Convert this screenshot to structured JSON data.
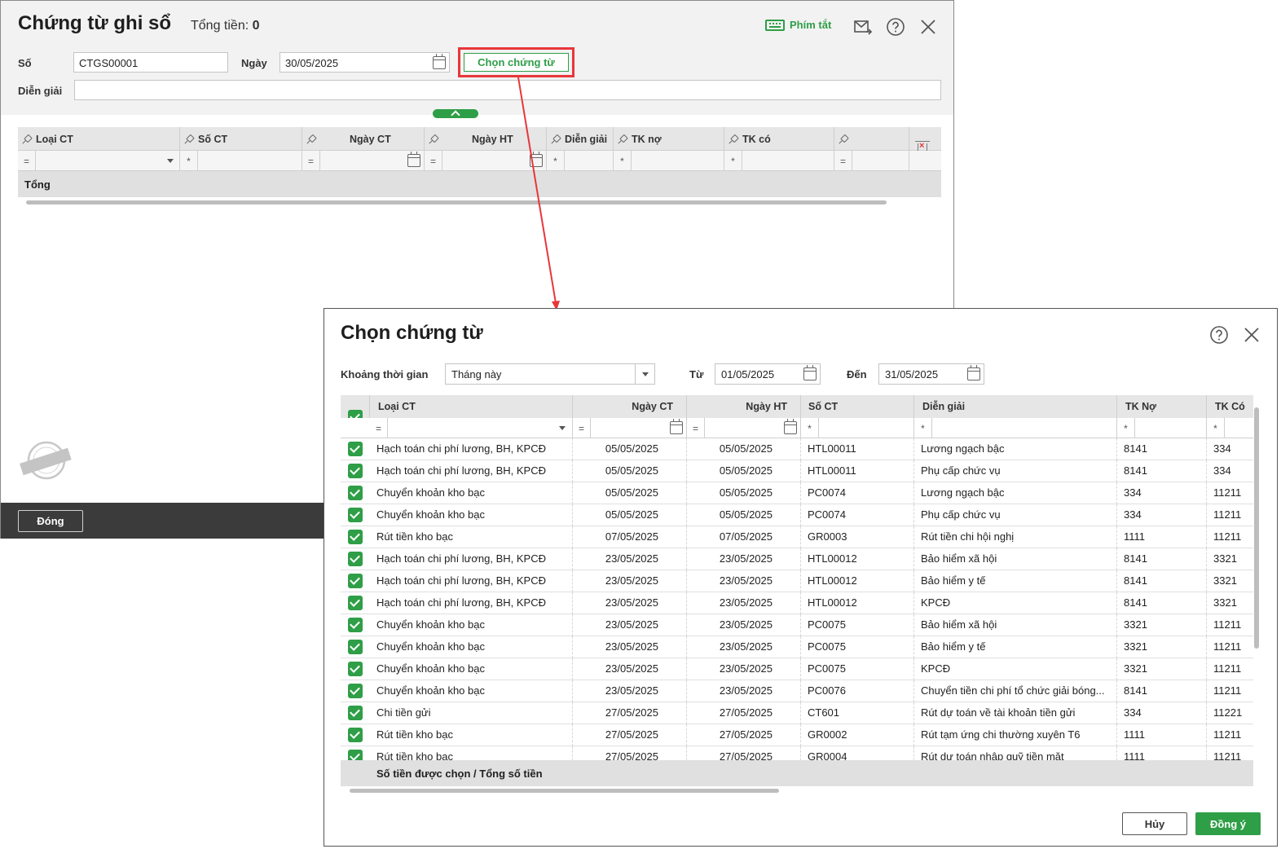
{
  "colors": {
    "accent": "#2e9e47",
    "highlight": "#e8363a",
    "footer_dark": "#3b3b3b"
  },
  "main": {
    "title": "Chứng từ ghi sổ",
    "total_label": "Tổng tiền:",
    "total_value": "0",
    "shortcut_label": "Phím tắt",
    "so_label": "Số",
    "so_value": "CTGS00001",
    "ngay_label": "Ngày",
    "ngay_value": "30/05/2025",
    "choose_button": "Chọn chứng từ",
    "dien_giai_label": "Diễn giải",
    "dien_giai_value": "",
    "grid": {
      "columns": [
        "Loại CT",
        "Số CT",
        "Ngày CT",
        "Ngày HT",
        "Diễn giải",
        "TK nợ",
        "TK có",
        ""
      ],
      "filter_ops": [
        "=",
        "*",
        "=",
        "=",
        "*",
        "*",
        "*",
        "="
      ],
      "total_label": "Tổng"
    },
    "close_button": "Đóng",
    "watermark": "DỮ LIỆU MẪU"
  },
  "dialog": {
    "title": "Chọn chứng từ",
    "period_label": "Khoảng thời gian",
    "period_value": "Tháng này",
    "from_label": "Từ",
    "from_value": "01/05/2025",
    "to_label": "Đến",
    "to_value": "31/05/2025",
    "columns": [
      "Loại CT",
      "Ngày CT",
      "Ngày HT",
      "Số CT",
      "Diễn giải",
      "TK Nợ",
      "TK Có"
    ],
    "filter_ops": [
      "=",
      "=",
      "=",
      "*",
      "*",
      "*",
      "*"
    ],
    "rows": [
      {
        "loai": "Hạch toán chi phí lương, BH, KPCĐ",
        "ngay_ct": "05/05/2025",
        "ngay_ht": "05/05/2025",
        "so": "HTL00011",
        "dien_giai": "Lương ngạch bậc",
        "tk_no": "8141",
        "tk_co": "334"
      },
      {
        "loai": "Hạch toán chi phí lương, BH, KPCĐ",
        "ngay_ct": "05/05/2025",
        "ngay_ht": "05/05/2025",
        "so": "HTL00011",
        "dien_giai": "Phụ cấp chức vụ",
        "tk_no": "8141",
        "tk_co": "334"
      },
      {
        "loai": "Chuyển khoản kho bạc",
        "ngay_ct": "05/05/2025",
        "ngay_ht": "05/05/2025",
        "so": "PC0074",
        "dien_giai": "Lương ngạch bậc",
        "tk_no": "334",
        "tk_co": "11211"
      },
      {
        "loai": "Chuyển khoản kho bạc",
        "ngay_ct": "05/05/2025",
        "ngay_ht": "05/05/2025",
        "so": "PC0074",
        "dien_giai": "Phụ cấp chức vụ",
        "tk_no": "334",
        "tk_co": "11211"
      },
      {
        "loai": "Rút tiền kho bạc",
        "ngay_ct": "07/05/2025",
        "ngay_ht": "07/05/2025",
        "so": "GR0003",
        "dien_giai": "Rút tiền chi hội nghị",
        "tk_no": "1111",
        "tk_co": "11211"
      },
      {
        "loai": "Hạch toán chi phí lương, BH, KPCĐ",
        "ngay_ct": "23/05/2025",
        "ngay_ht": "23/05/2025",
        "so": "HTL00012",
        "dien_giai": "Bảo hiểm xã hội",
        "tk_no": "8141",
        "tk_co": "3321"
      },
      {
        "loai": "Hạch toán chi phí lương, BH, KPCĐ",
        "ngay_ct": "23/05/2025",
        "ngay_ht": "23/05/2025",
        "so": "HTL00012",
        "dien_giai": "Bảo hiểm y tế",
        "tk_no": "8141",
        "tk_co": "3321"
      },
      {
        "loai": "Hạch toán chi phí lương, BH, KPCĐ",
        "ngay_ct": "23/05/2025",
        "ngay_ht": "23/05/2025",
        "so": "HTL00012",
        "dien_giai": "KPCĐ",
        "tk_no": "8141",
        "tk_co": "3321"
      },
      {
        "loai": "Chuyển khoản kho bạc",
        "ngay_ct": "23/05/2025",
        "ngay_ht": "23/05/2025",
        "so": "PC0075",
        "dien_giai": "Bảo hiểm xã hội",
        "tk_no": "3321",
        "tk_co": "11211"
      },
      {
        "loai": "Chuyển khoản kho bạc",
        "ngay_ct": "23/05/2025",
        "ngay_ht": "23/05/2025",
        "so": "PC0075",
        "dien_giai": "Bảo hiểm y tế",
        "tk_no": "3321",
        "tk_co": "11211"
      },
      {
        "loai": "Chuyển khoản kho bạc",
        "ngay_ct": "23/05/2025",
        "ngay_ht": "23/05/2025",
        "so": "PC0075",
        "dien_giai": "KPCĐ",
        "tk_no": "3321",
        "tk_co": "11211"
      },
      {
        "loai": "Chuyển khoản kho bạc",
        "ngay_ct": "23/05/2025",
        "ngay_ht": "23/05/2025",
        "so": "PC0076",
        "dien_giai": "Chuyển tiền chi phí tổ chức giải bóng...",
        "tk_no": "8141",
        "tk_co": "11211"
      },
      {
        "loai": "Chi tiền gửi",
        "ngay_ct": "27/05/2025",
        "ngay_ht": "27/05/2025",
        "so": "CT601",
        "dien_giai": "Rút dự toán về tài khoản tiền gửi",
        "tk_no": "334",
        "tk_co": "11221"
      },
      {
        "loai": "Rút tiền kho bạc",
        "ngay_ct": "27/05/2025",
        "ngay_ht": "27/05/2025",
        "so": "GR0002",
        "dien_giai": "Rút tạm ứng chi thường xuyên T6",
        "tk_no": "1111",
        "tk_co": "11211"
      },
      {
        "loai": "Rút tiền kho bạc",
        "ngay_ct": "27/05/2025",
        "ngay_ht": "27/05/2025",
        "so": "GR0004",
        "dien_giai": "Rút dự toán nhập quỹ tiền mặt",
        "tk_no": "1111",
        "tk_co": "11211"
      }
    ],
    "total_label": "Số tiền được chọn / Tổng số tiền",
    "cancel_button": "Hủy",
    "ok_button": "Đồng ý"
  }
}
